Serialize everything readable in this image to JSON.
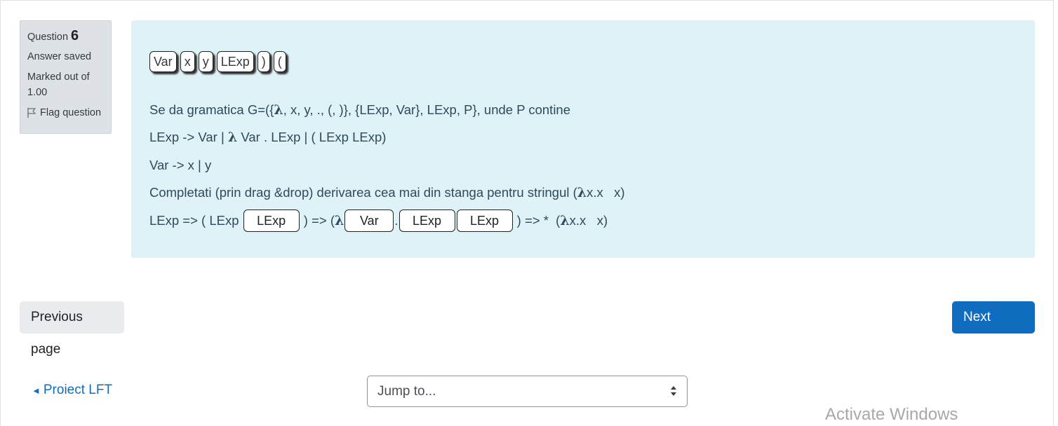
{
  "info": {
    "question_label": "Question",
    "question_number": "6",
    "state": "Answer saved",
    "grade": "Marked out of 1.00",
    "flag_label": "Flag question"
  },
  "drag_items": [
    "Var",
    "x",
    "y",
    "LExp",
    ")",
    "("
  ],
  "question_text": {
    "line1": {
      "pre": "Se da gramatica G=({",
      "lambda": "λ",
      "post": ", x, y, ., (, )}, {LExp, Var}, LExp, P}, unde P contine"
    },
    "line2": {
      "pre": "LExp -> Var | ",
      "lambda": "λ",
      "post": " Var . LExp | ( LExp LExp)"
    },
    "line3": "Var -> x | y",
    "line4": {
      "pre": "Completati (prin drag &drop) derivarea cea mai din stanga pentru stringul (",
      "lambda": "λ",
      "post": "x.x   x)"
    },
    "line5": {
      "seg1": "LExp => ( LExp ",
      "drop1": "LExp",
      "seg2": " ) => (",
      "lambda1": "λ",
      "drop2": "Var",
      "seg3": ".",
      "drop3": "LExp",
      "drop4": "LExp",
      "seg4": " ) => *  (",
      "lambda2": "λ",
      "seg5": "x.x   x)"
    }
  },
  "navigation": {
    "prev_label": "Previous page",
    "next_label": "Next page",
    "back_link": "Proiect LFT",
    "back_arrow": "◄",
    "jump_placeholder": "Jump to..."
  },
  "watermark": "Activate Windows",
  "colors": {
    "accent": "#0f6cbf",
    "content_bg": "#def2f8",
    "info_bg": "#dee2e6"
  }
}
